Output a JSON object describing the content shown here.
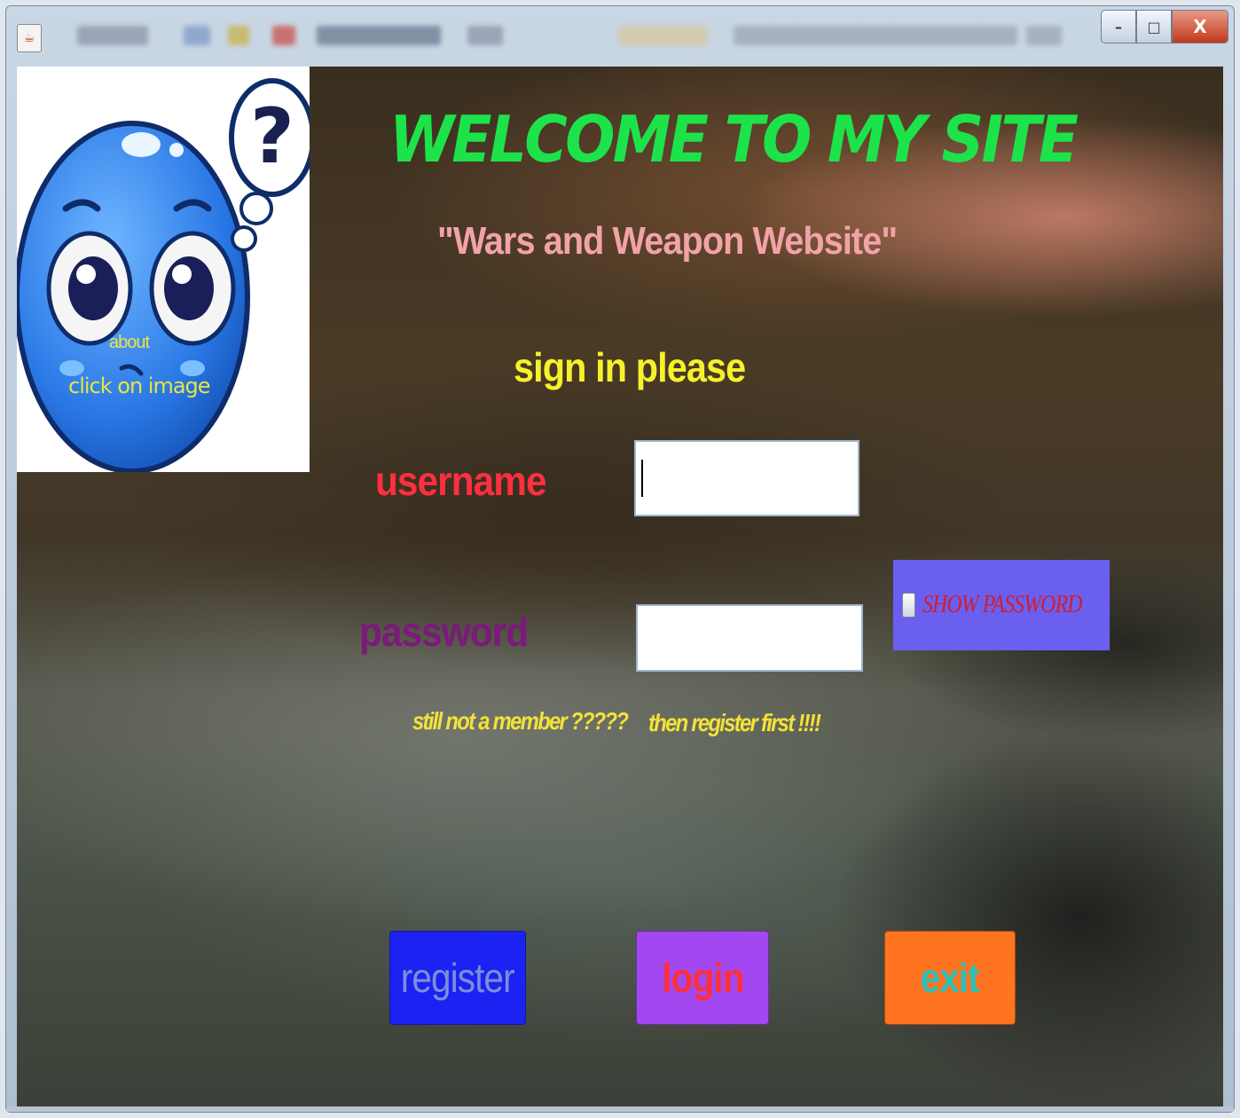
{
  "window": {
    "controls": {
      "minimize": "–",
      "maximize": "□",
      "close": "X"
    }
  },
  "about": {
    "label": "about",
    "hint": "click on image",
    "thought_symbol": "?"
  },
  "header": {
    "welcome": "WELCOME TO MY SITE",
    "subtitle": "\"Wars and Weapon Website\""
  },
  "form": {
    "prompt": "sign in please",
    "username_label": "username",
    "username_value": "",
    "password_label": "password",
    "password_value": "",
    "show_password_label": "SHOW PASSWORD",
    "show_password_checked": false,
    "not_member_text": "still not a member ?????",
    "register_first_text": "then register first !!!!"
  },
  "buttons": {
    "register": "register",
    "login": "login",
    "exit": "exit"
  },
  "colors": {
    "welcome": "#1de34b",
    "subtitle": "#f2a3a7",
    "prompt": "#f6f12a",
    "username_label": "#ff2f3f",
    "password_label": "#7a1a7a",
    "show_password_bg": "#6b5ff0",
    "register_bg": "#1b22f2",
    "login_bg": "#a348f0",
    "exit_bg": "#ff7420"
  }
}
